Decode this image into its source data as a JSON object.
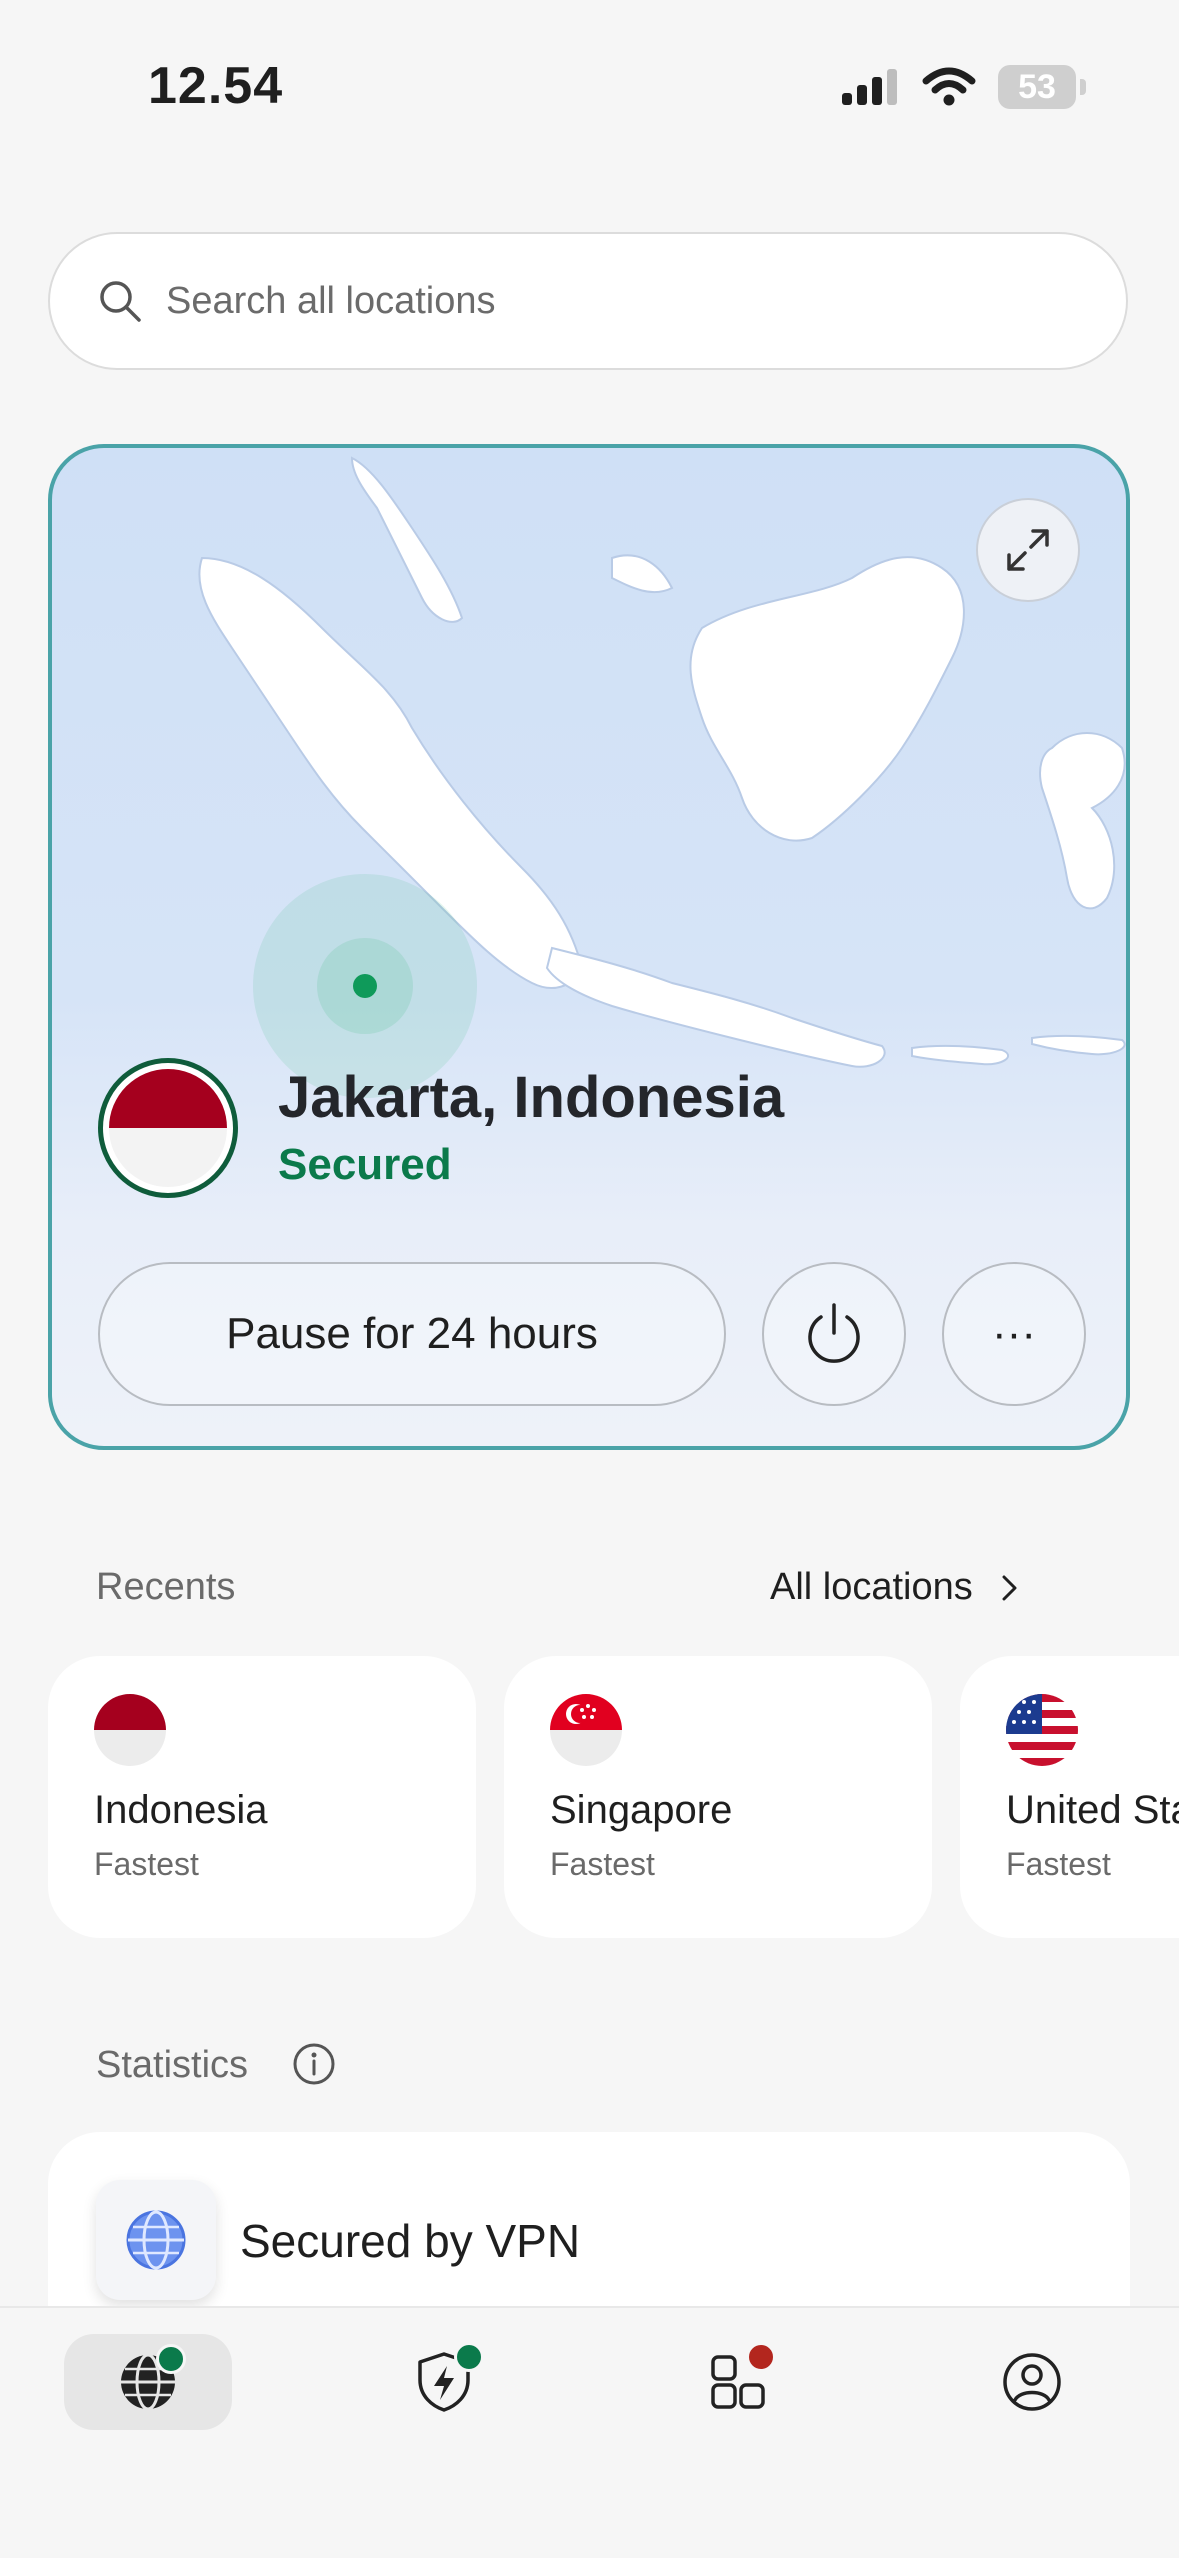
{
  "status_bar": {
    "time": "12.54",
    "battery": "53"
  },
  "search": {
    "placeholder": "Search all locations"
  },
  "connection": {
    "location": "Jakarta, Indonesia",
    "status": "Secured",
    "pause_label": "Pause for 24 hours",
    "more_label": "···"
  },
  "recents": {
    "label": "Recents",
    "all_locations_label": "All locations",
    "items": [
      {
        "country": "Indonesia",
        "detail": "Fastest"
      },
      {
        "country": "Singapore",
        "detail": "Fastest"
      },
      {
        "country": "United States",
        "detail": "Fastest"
      }
    ]
  },
  "statistics": {
    "label": "Statistics",
    "item_title": "Secured by VPN"
  },
  "colors": {
    "accent_green": "#0b7a4b",
    "card_border": "#4aa3a8",
    "flag_red": "#a5001e",
    "badge_red": "#b3261e"
  },
  "bottom_nav": {
    "items": [
      "globe-icon",
      "shield-bolt-icon",
      "apps-icon",
      "account-icon"
    ]
  }
}
